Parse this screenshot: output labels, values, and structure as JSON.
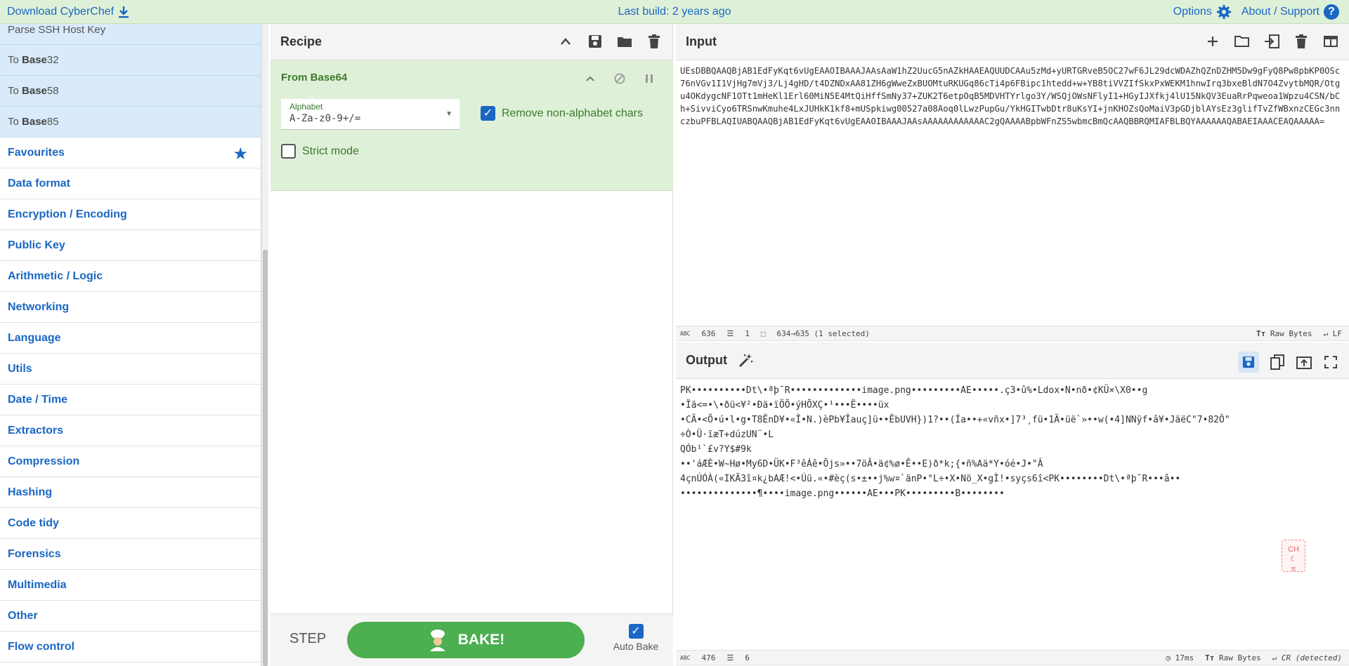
{
  "banner": {
    "download_label": "Download CyberChef",
    "last_build": "Last build: 2 years ago",
    "options_label": "Options",
    "about_label": "About / Support"
  },
  "operations": {
    "items": [
      {
        "prefix": "Parse SSH Host Key",
        "bold": ""
      },
      {
        "prefix": "To ",
        "bold": "Base",
        "suffix": "32"
      },
      {
        "prefix": "To ",
        "bold": "Base",
        "suffix": "58"
      },
      {
        "prefix": "To ",
        "bold": "Base",
        "suffix": "85"
      }
    ],
    "categories": [
      "Favourites",
      "Data format",
      "Encryption / Encoding",
      "Public Key",
      "Arithmetic / Logic",
      "Networking",
      "Language",
      "Utils",
      "Date / Time",
      "Extractors",
      "Compression",
      "Hashing",
      "Code tidy",
      "Forensics",
      "Multimedia",
      "Other",
      "Flow control"
    ]
  },
  "recipe": {
    "title": "Recipe",
    "operation": {
      "name": "From Base64",
      "alphabet_label": "Alphabet",
      "alphabet_value": "A-Za-z0-9+/=",
      "remove_label": "Remove non-alphabet chars",
      "strict_label": "Strict mode"
    },
    "step_label": "STEP",
    "bake_label": "BAKE!",
    "auto_bake_label": "Auto Bake"
  },
  "input": {
    "title": "Input",
    "text": "UEsDBBQAAQBjAB1EdFyKqt6vUgEAAOIBAAAJAAsAaW1hZ2UucG5nAZkHAAEAQUUDCAAu5zMd+yURTGRveB5OC27wF6JL29dcWDAZhQZnDZHM5Dw9gFyQ8Pw8pbKP0OSc76nVGv1I1VjHg7mVj3/Lj4gHD/t4DZNDxAA81ZH6gWweZxBUOMtuRKUGq86cTi4p6FBipc1htedd+w+YB8tiVVZIfSkxPxWEKM1hnwIrq3bxeBldN7O4ZvytbMQR/Otgu4OKdygcNF1OTt1mHeKl1Erl60MiN5E4MtQiHffSmNy37+ZUK2T6etpOqB5MDVHTYrlgo3Y/WSQjOWsNFlyI1+HGyIJXfkj4lU15NkQV3EuaRrPqweoa1Wpzu4CSN/bCh+SivviCyo6TRSnwKmuhe4LxJUHkK1kf8+mUSpkiwg00527a08Aoq0lLwzPupGu/YkHGITwbDtr8uKsYI+jnKHOZsQoMaiV3pGDjblAYsEz3glifTvZfWBxnzCEGc3nnczbuPFBLAQIUABQAAQBjAB1EdFyKqt6vUgEAAOIBAAAJAAsAAAAAAAAAAAAC2gQAAAABpbWFnZS5wbmcBmQcAAQBBRQMIAFBLBQYAAAAAAQABAEIAAACEAQAAAAA=",
    "status_chars": "636",
    "status_lines": "1",
    "status_selection": "634→635 (1 selected)",
    "raw_bytes": "Raw Bytes",
    "eol": "LF"
  },
  "output": {
    "title": "Output",
    "lines": [
      "PK••••••••••Dt\\•ªþ¯R•••••••••••••image.png•••••••••AE•••••.ç3•û%•Ldox•N•nð•¢KÜ×\\X0••g",
      "•Ïä<=•\\•ðü<¥²•Ðä•ïÖÕ•ýHÕXÇ•¹•••Ë••••üx",
      "•CÄ•<Õ•ú•l•g•T8ËnD¥•«Î•N.)èPb¥Îauç]ü••ËbUVH})1?••(Ía••+«vñx•]7³¸fü•1Ä•üë`»••w(•4]NNÿf•â¥•JäëC\"7•82Ô\"",
      "÷Ò•Ü·ïæT+dúzUN¨•L",
      "QÓb¹`£v?Y$#9k",
      "••'áÆÈ•W~Hø•My6D•ÜK•F³êÁê•Õjs»••7öÂ•ä¢%ø•Ê••E)ð*k;{•ñ%Aä*Y•óé•J•\"Â",
      "4çnÚÓÀ(«IKÃ3î¤k¿bAÆ!<•Úü.«•#èç(s•±••j%w¤`änP•°L÷•X•Nö_X•gÌ!•syçs6î<PK••••••••Dt\\•ªþ¯R•••â••",
      "••••••••••••••¶••••image.png••••••AE•••PK•••••••••B••••••••"
    ],
    "status_chars": "476",
    "status_lines": "6",
    "time": "17ms",
    "raw_bytes": "Raw Bytes",
    "eol": "CR (detected)",
    "badge": "CH"
  },
  "colors": {
    "accent": "#1a67c4",
    "banner_bg": "#dff0d8",
    "bake_green": "#4caf50",
    "op_highlight": "#d9eafa"
  }
}
